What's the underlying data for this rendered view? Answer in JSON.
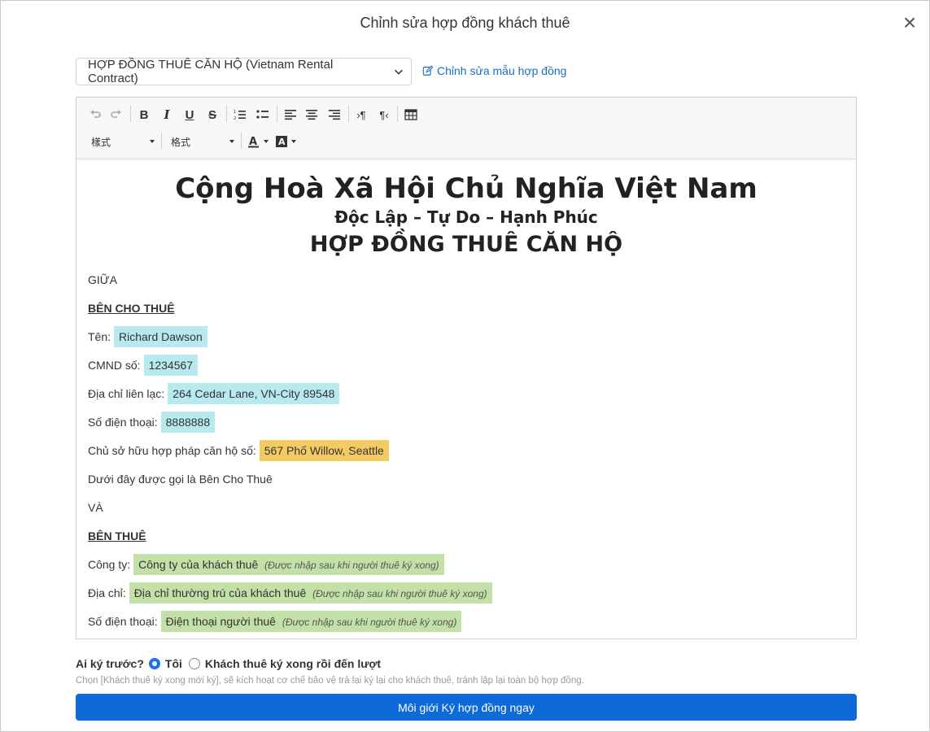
{
  "modal": {
    "title": "Chỉnh sửa hợp đồng khách thuê",
    "close_label": "×"
  },
  "template": {
    "selected": "HỢP ĐỒNG THUÊ CĂN HỘ (Vietnam Rental Contract)",
    "edit_link": "Chỉnh sửa mẫu hợp đồng"
  },
  "toolbar": {
    "style_dropdown": "樣式",
    "format_dropdown": "格式"
  },
  "document": {
    "heading1": "Cộng Hoà Xã Hội Chủ Nghĩa Việt Nam",
    "heading2": "Độc Lập – Tự Do – Hạnh Phúc",
    "heading3": "HỢP ĐỒNG THUÊ CĂN HỘ",
    "between": "GIỮA",
    "landlord_section": "BÊN CHO THUÊ",
    "landlord_name_label": "Tên:",
    "landlord_name": "Richard Dawson",
    "landlord_id_label": "CMND số:",
    "landlord_id": "1234567",
    "landlord_address_label": "Địa chỉ liên lạc:",
    "landlord_address": "264 Cedar Lane, VN-City 89548",
    "landlord_phone_label": "Số điện thoại:",
    "landlord_phone": "8888888",
    "owner_label": "Chủ sở hữu hợp pháp căn hộ số:",
    "owner_unit": "567 Phố Willow, Seattle",
    "landlord_note": "Dưới đây được gọi là Bên Cho Thuê",
    "and": "VÀ",
    "tenant_section": "BÊN THUÊ",
    "tenant_company_label": "Công ty:",
    "tenant_company": "Công ty của khách thuê",
    "tenant_address_label": "Địa chỉ:",
    "tenant_address": "Địa chỉ thường trú của khách thuê",
    "tenant_phone_label": "Số điện thoại:",
    "tenant_phone": "Điện thoại người thuê",
    "hint": "(Được nhập sau khi người thuê ký xong)"
  },
  "signing": {
    "question": "Ai ký trước?",
    "option_me": "Tôi",
    "option_tenant": "Khách thuê ký xong rồi đến lượt",
    "selected": "Tôi",
    "helper": "Chọn [Khách thuê ký xong mới ký], sẽ kích hoạt cơ chế bảo vệ trả lại ký lại cho khách thuê, tránh lặp lại toàn bộ hợp đồng.",
    "submit": "Môi giới Ký hợp đồng ngay"
  },
  "colors": {
    "accent": "#0d6ad8",
    "highlight_blue": "#b7e9ef",
    "highlight_yellow": "#f2cc63",
    "highlight_green": "#c2e0a7"
  }
}
